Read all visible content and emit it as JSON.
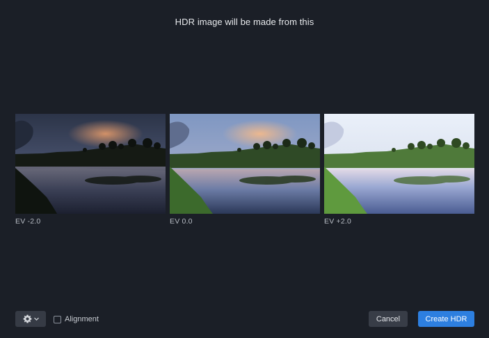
{
  "dialog": {
    "title": "HDR image will be made from this"
  },
  "brackets": [
    {
      "ev_label": "EV -2.0"
    },
    {
      "ev_label": "EV 0.0"
    },
    {
      "ev_label": "EV +2.0"
    }
  ],
  "footer": {
    "settings_icon": "gear-icon",
    "dropdown_icon": "chevron-down-icon",
    "alignment_label": "Alignment",
    "alignment_checked": false,
    "cancel_label": "Cancel",
    "create_label": "Create HDR"
  },
  "colors": {
    "background": "#1b1f27",
    "accent": "#2d7fe0",
    "button": "#383d47"
  }
}
